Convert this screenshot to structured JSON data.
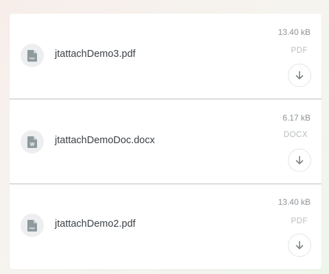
{
  "attachments": [
    {
      "name": "jtattachDemo3.pdf",
      "size": "13.40 kB",
      "type": "PDF",
      "icon": "pdf-file-icon",
      "icon_text": "PDF"
    },
    {
      "name": "jtattachDemoDoc.docx",
      "size": "6.17 kB",
      "type": "DOCX",
      "icon": "word-file-icon",
      "icon_text": "W"
    },
    {
      "name": "jtattachDemo2.pdf",
      "size": "13.40 kB",
      "type": "PDF",
      "icon": "pdf-file-icon",
      "icon_text": "PDF"
    }
  ],
  "colors": {
    "icon_gray": "#8f9a9f",
    "text": "#3c4146",
    "muted": "#8e9397",
    "divider": "#bdbdbd"
  }
}
